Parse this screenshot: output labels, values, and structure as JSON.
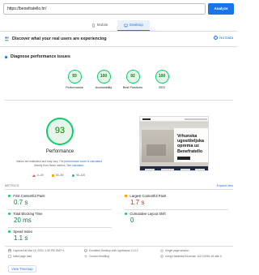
{
  "search": {
    "url": "https://benefratello.hr/",
    "analyze_label": "Analyze"
  },
  "tabs": [
    {
      "label": "Mobile",
      "icon": "mobile-icon"
    },
    {
      "label": "Desktop",
      "icon": "desktop-icon",
      "active": true
    }
  ],
  "crux": {
    "title": "Discover what your real users are experiencing",
    "status": "No Data"
  },
  "diagnose": {
    "title": "Diagnose performance issues"
  },
  "categories": [
    {
      "label": "Performance",
      "score": "93"
    },
    {
      "label": "Accessibility",
      "score": "100"
    },
    {
      "label": "Best Practices",
      "score": "92"
    },
    {
      "label": "SEO",
      "score": "100"
    }
  ],
  "performance": {
    "score": "93",
    "title": "Performance",
    "note_part1": "Values are estimated and may vary. The",
    "note_link1": "performance score is calculated",
    "note_part2": "directly from these metrics.",
    "note_link2": "See calculator.",
    "legend": [
      {
        "range": "0–49",
        "color": "#ff4e42"
      },
      {
        "range": "50–89",
        "color": "#ffa400"
      },
      {
        "range": "90–100",
        "color": "#0cce6b"
      }
    ]
  },
  "screenshot": {
    "headline": "Vrhunska ugostiteljska oprema uz Benefratello"
  },
  "metrics": {
    "section_label": "METRICS",
    "expand_label": "Expand view",
    "items": [
      {
        "label": "First Contentful Paint",
        "value": "0.7 s",
        "rating": "good"
      },
      {
        "label": "Largest Contentful Paint",
        "value": "1.7 s",
        "rating": "average"
      },
      {
        "label": "Total Blocking Time",
        "value": "20 ms",
        "rating": "good"
      },
      {
        "label": "Cumulative Layout Shift",
        "value": "0",
        "rating": "good"
      },
      {
        "label": "Speed Index",
        "value": "1.1 s",
        "rating": "good"
      }
    ]
  },
  "runinfo": {
    "captured": "Captured at Mar 15, 2024, 1:45 PM GMT+1",
    "emulated": "Emulated Desktop with Lighthouse 11.0.0",
    "single_load": "Single page session",
    "initial_load": "Initial page load",
    "throttling": "Custom throttling",
    "browser": "Using HeadlessChromium 122.0.6261.94 with lr"
  },
  "treemap_label": "View Treemap",
  "colors": {
    "accent": "#1a73e8",
    "good": "#0cce6b",
    "average": "#ffa400",
    "poor": "#ff4e42"
  }
}
